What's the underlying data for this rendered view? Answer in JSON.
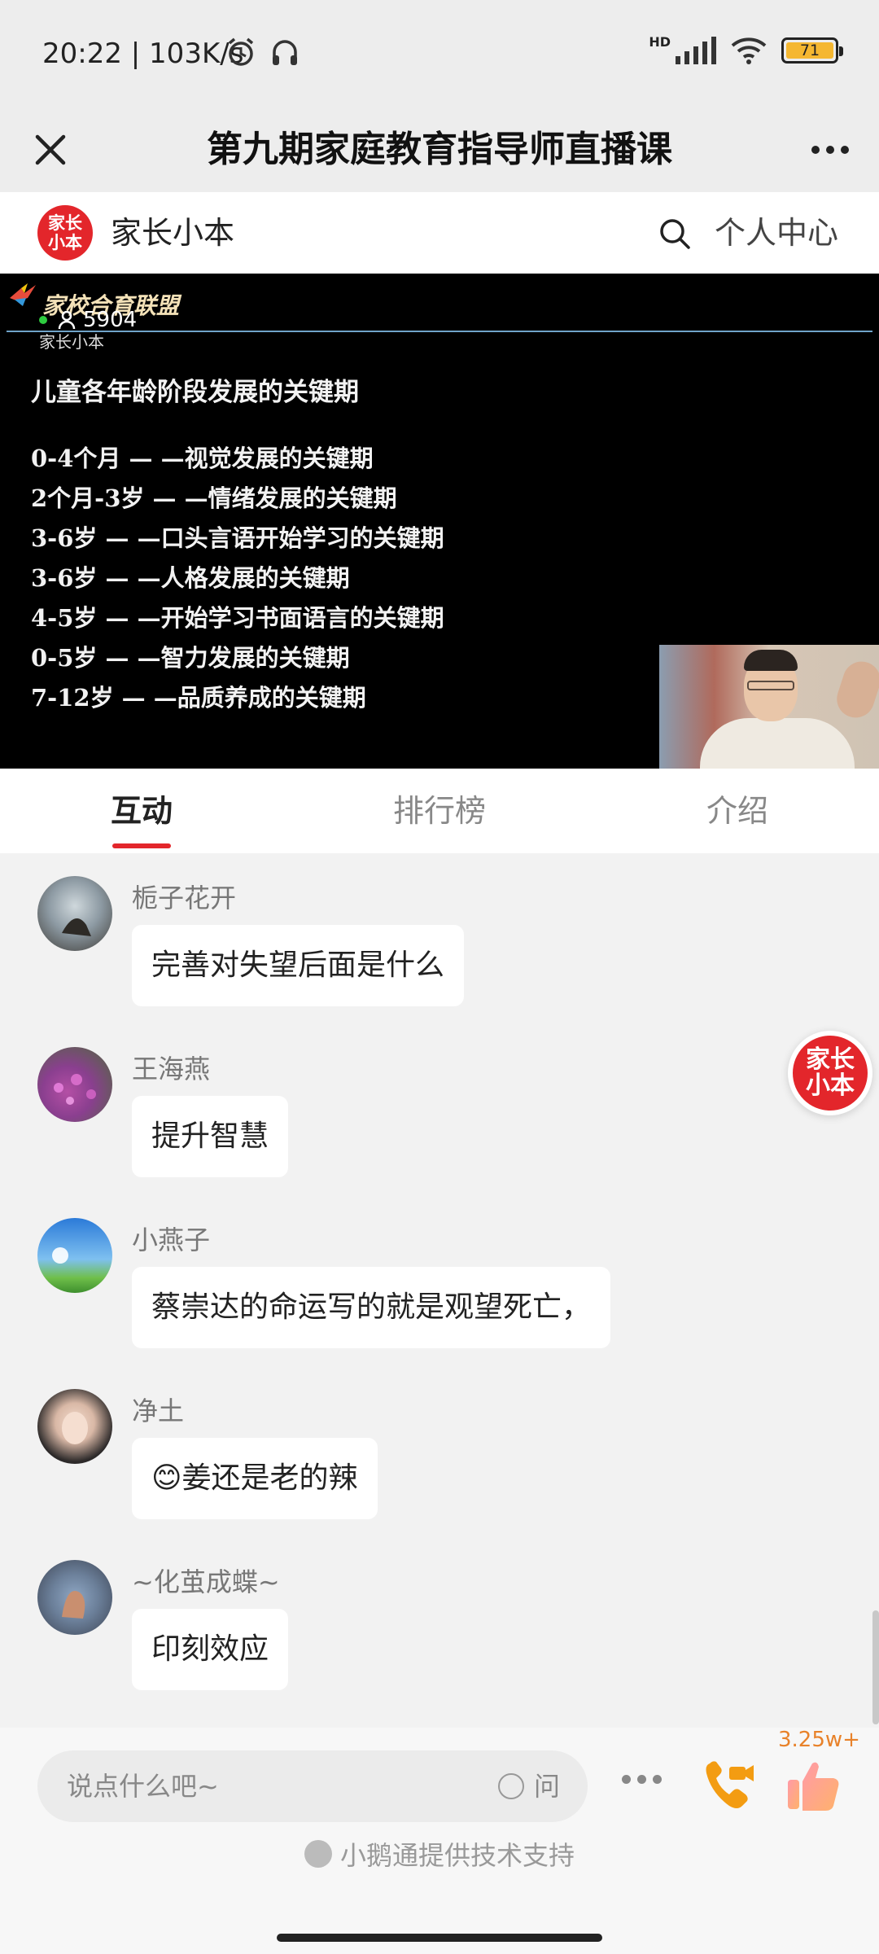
{
  "status_bar": {
    "time": "20:22 | 103K/s",
    "network_label": "HD",
    "battery_level": "71"
  },
  "title_bar": {
    "title": "第九期家庭教育指导师直播课"
  },
  "brand_bar": {
    "logo_text": "家长小本",
    "brand_name": "家长小本",
    "personal_center": "个人中心"
  },
  "video": {
    "banner": "家校合育联盟",
    "watermark": "家长小本",
    "viewers": "5904",
    "slide": {
      "heading": "儿童各年龄阶段发展的关键期",
      "rows": [
        "0-4个月 — —视觉发展的关键期",
        "2个月-3岁 — —情绪发展的关键期",
        "3-6岁 — —口头言语开始学习的关键期",
        "3-6岁 — —人格发展的关键期",
        "4-5岁 — —开始学习书面语言的关键期",
        "0-5岁 — —智力发展的关键期",
        "7-12岁 — —品质养成的关键期"
      ]
    }
  },
  "tabs": [
    {
      "label": "互动",
      "active": true
    },
    {
      "label": "排行榜",
      "active": false
    },
    {
      "label": "介绍",
      "active": false
    }
  ],
  "messages": [
    {
      "user": "栀子花开",
      "text": "完善对失望后面是什么"
    },
    {
      "user": "王海燕",
      "text": "提升智慧"
    },
    {
      "user": "小燕子",
      "text": "蔡崇达的命运写的就是观望死亡，"
    },
    {
      "user": "净土",
      "text": "😊姜还是老的辣"
    },
    {
      "user": "~化茧成蝶~",
      "text": "印刻效应"
    }
  ],
  "floating_logo": "家长小本",
  "bottom_bar": {
    "input_placeholder": "说点什么吧~",
    "ask_label": "问",
    "like_count": "3.25w+",
    "support_text": "小鹅通提供技术支持"
  },
  "colors": {
    "brand_red": "#e3262b",
    "like_orange": "#e8822a",
    "call_orange": "#f39c12"
  }
}
